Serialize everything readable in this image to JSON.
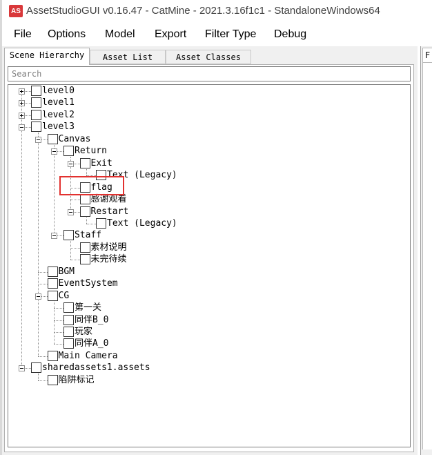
{
  "window": {
    "title": "AssetStudioGUI v0.16.47 - CatMine - 2021.3.16f1c1 - StandaloneWindows64",
    "icon_text": "AS"
  },
  "menu": [
    "File",
    "Options",
    "Model",
    "Export",
    "Filter Type",
    "Debug"
  ],
  "tabs": [
    {
      "label": "Scene Hierarchy",
      "active": true
    },
    {
      "label": "Asset List",
      "active": false
    },
    {
      "label": "Asset Classes",
      "active": false
    }
  ],
  "right_tab_label": "F",
  "search": {
    "placeholder": "Search"
  },
  "tree": [
    {
      "label": "level0",
      "depth": 0,
      "expander": "plus"
    },
    {
      "label": "level1",
      "depth": 0,
      "expander": "plus"
    },
    {
      "label": "level2",
      "depth": 0,
      "expander": "plus"
    },
    {
      "label": "level3",
      "depth": 0,
      "expander": "minus"
    },
    {
      "label": "Canvas",
      "depth": 1,
      "expander": "minus"
    },
    {
      "label": "Return",
      "depth": 2,
      "expander": "minus"
    },
    {
      "label": "Exit",
      "depth": 3,
      "expander": "minus"
    },
    {
      "label": "Text (Legacy)",
      "depth": 4,
      "expander": "none"
    },
    {
      "label": "flag",
      "depth": 3,
      "expander": "none"
    },
    {
      "label": "感谢观看",
      "depth": 3,
      "expander": "none"
    },
    {
      "label": "Restart",
      "depth": 3,
      "expander": "minus"
    },
    {
      "label": "Text (Legacy)",
      "depth": 4,
      "expander": "none"
    },
    {
      "label": "Staff",
      "depth": 2,
      "expander": "minus"
    },
    {
      "label": "素材说明",
      "depth": 3,
      "expander": "none"
    },
    {
      "label": "未完待续",
      "depth": 3,
      "expander": "none"
    },
    {
      "label": "BGM",
      "depth": 1,
      "expander": "none"
    },
    {
      "label": "EventSystem",
      "depth": 1,
      "expander": "none"
    },
    {
      "label": "CG",
      "depth": 1,
      "expander": "minus"
    },
    {
      "label": "第一关",
      "depth": 2,
      "expander": "none"
    },
    {
      "label": "同伴B_0",
      "depth": 2,
      "expander": "none"
    },
    {
      "label": "玩家",
      "depth": 2,
      "expander": "none"
    },
    {
      "label": "同伴A_0",
      "depth": 2,
      "expander": "none"
    },
    {
      "label": "Main Camera",
      "depth": 1,
      "expander": "none"
    },
    {
      "label": "sharedassets1.assets",
      "depth": 0,
      "expander": "minus"
    },
    {
      "label": "陷阱标记",
      "depth": 1,
      "expander": "none"
    }
  ],
  "highlighted_item": "flag",
  "highlight_color": "#e2312f"
}
